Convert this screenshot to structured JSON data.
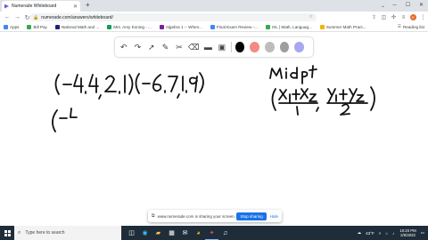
{
  "browser": {
    "tab_title": "Numerade Whiteboard",
    "url": "numerade.com/answers/whiteboard/",
    "profile_initial": "E"
  },
  "bookmarks": {
    "items": [
      {
        "label": "Apps",
        "color": "#4285f4"
      },
      {
        "label": "Bill Pay",
        "color": "#34a853"
      },
      {
        "label": "National Math and ...",
        "color": "#1a237e"
      },
      {
        "label": "Mrs. Amy Koning - ...",
        "color": "#0f9d58"
      },
      {
        "label": "Algebra 1 -- When...",
        "color": "#7b1fa2"
      },
      {
        "label": "Final Exam Review -...",
        "color": "#4285f4"
      },
      {
        "label": "IXL | Math, Languag...",
        "color": "#34a853"
      },
      {
        "label": "Summer Math Pract...",
        "color": "#f4b400"
      }
    ],
    "reading_list": "Reading list"
  },
  "toolbar": {
    "colors": [
      "#000000",
      "#f28b82",
      "#bdbdbd",
      "#9e9e9e",
      "#a8a8f0"
    ]
  },
  "share": {
    "message": "www.numerade.com is sharing your screen.",
    "stop_label": "Stop sharing",
    "hide_label": "Hide"
  },
  "taskbar": {
    "search_placeholder": "Type here to search",
    "temperature": "43°F",
    "time": "10:20 PM",
    "date": "2/6/2022"
  }
}
